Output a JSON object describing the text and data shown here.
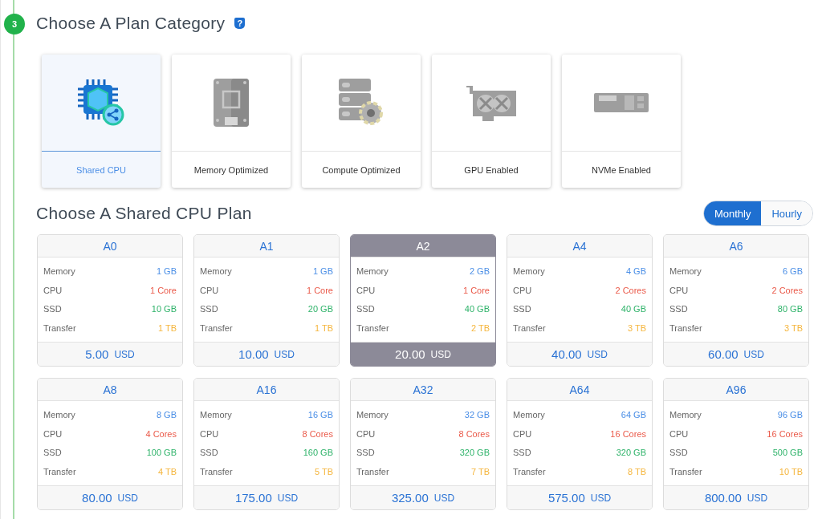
{
  "step": {
    "number": "3"
  },
  "category_section": {
    "title": "Choose A Plan Category",
    "help_icon": "?"
  },
  "categories": [
    {
      "label": "Shared CPU",
      "kind": "cpu",
      "selected": true
    },
    {
      "label": "Memory Optimized",
      "kind": "memory",
      "selected": false
    },
    {
      "label": "Compute Optimized",
      "kind": "server",
      "selected": false
    },
    {
      "label": "GPU Enabled",
      "kind": "gpu",
      "selected": false
    },
    {
      "label": "NVMe Enabled",
      "kind": "nvme",
      "selected": false
    }
  ],
  "plan_section": {
    "title": "Choose A Shared CPU Plan"
  },
  "billing_toggle": [
    {
      "label": "Monthly",
      "selected": true
    },
    {
      "label": "Hourly",
      "selected": false
    }
  ],
  "plans": [
    {
      "name": "A0",
      "selected": false,
      "specs": [
        {
          "label": "Memory",
          "value": "1 GB",
          "kind": "memory"
        },
        {
          "label": "CPU",
          "value": "1 Core",
          "kind": "cpu"
        },
        {
          "label": "SSD",
          "value": "10 GB",
          "kind": "ssd"
        },
        {
          "label": "Transfer",
          "value": "1 TB",
          "kind": "transfer"
        }
      ],
      "price": "5.00",
      "currency": "USD"
    },
    {
      "name": "A1",
      "selected": false,
      "specs": [
        {
          "label": "Memory",
          "value": "1 GB",
          "kind": "memory"
        },
        {
          "label": "CPU",
          "value": "1 Core",
          "kind": "cpu"
        },
        {
          "label": "SSD",
          "value": "20 GB",
          "kind": "ssd"
        },
        {
          "label": "Transfer",
          "value": "1 TB",
          "kind": "transfer"
        }
      ],
      "price": "10.00",
      "currency": "USD"
    },
    {
      "name": "A2",
      "selected": true,
      "specs": [
        {
          "label": "Memory",
          "value": "2 GB",
          "kind": "memory"
        },
        {
          "label": "CPU",
          "value": "1 Core",
          "kind": "cpu"
        },
        {
          "label": "SSD",
          "value": "40 GB",
          "kind": "ssd"
        },
        {
          "label": "Transfer",
          "value": "2 TB",
          "kind": "transfer"
        }
      ],
      "price": "20.00",
      "currency": "USD"
    },
    {
      "name": "A4",
      "selected": false,
      "specs": [
        {
          "label": "Memory",
          "value": "4 GB",
          "kind": "memory"
        },
        {
          "label": "CPU",
          "value": "2 Cores",
          "kind": "cpu"
        },
        {
          "label": "SSD",
          "value": "40 GB",
          "kind": "ssd"
        },
        {
          "label": "Transfer",
          "value": "3 TB",
          "kind": "transfer"
        }
      ],
      "price": "40.00",
      "currency": "USD"
    },
    {
      "name": "A6",
      "selected": false,
      "specs": [
        {
          "label": "Memory",
          "value": "6 GB",
          "kind": "memory"
        },
        {
          "label": "CPU",
          "value": "2 Cores",
          "kind": "cpu"
        },
        {
          "label": "SSD",
          "value": "80 GB",
          "kind": "ssd"
        },
        {
          "label": "Transfer",
          "value": "3 TB",
          "kind": "transfer"
        }
      ],
      "price": "60.00",
      "currency": "USD"
    },
    {
      "name": "A8",
      "selected": false,
      "specs": [
        {
          "label": "Memory",
          "value": "8 GB",
          "kind": "memory"
        },
        {
          "label": "CPU",
          "value": "4 Cores",
          "kind": "cpu"
        },
        {
          "label": "SSD",
          "value": "100 GB",
          "kind": "ssd"
        },
        {
          "label": "Transfer",
          "value": "4 TB",
          "kind": "transfer"
        }
      ],
      "price": "80.00",
      "currency": "USD"
    },
    {
      "name": "A16",
      "selected": false,
      "specs": [
        {
          "label": "Memory",
          "value": "16 GB",
          "kind": "memory"
        },
        {
          "label": "CPU",
          "value": "8 Cores",
          "kind": "cpu"
        },
        {
          "label": "SSD",
          "value": "160 GB",
          "kind": "ssd"
        },
        {
          "label": "Transfer",
          "value": "5 TB",
          "kind": "transfer"
        }
      ],
      "price": "175.00",
      "currency": "USD"
    },
    {
      "name": "A32",
      "selected": false,
      "specs": [
        {
          "label": "Memory",
          "value": "32 GB",
          "kind": "memory"
        },
        {
          "label": "CPU",
          "value": "8 Cores",
          "kind": "cpu"
        },
        {
          "label": "SSD",
          "value": "320 GB",
          "kind": "ssd"
        },
        {
          "label": "Transfer",
          "value": "7 TB",
          "kind": "transfer"
        }
      ],
      "price": "325.00",
      "currency": "USD"
    },
    {
      "name": "A64",
      "selected": false,
      "specs": [
        {
          "label": "Memory",
          "value": "64 GB",
          "kind": "memory"
        },
        {
          "label": "CPU",
          "value": "16 Cores",
          "kind": "cpu"
        },
        {
          "label": "SSD",
          "value": "320 GB",
          "kind": "ssd"
        },
        {
          "label": "Transfer",
          "value": "8 TB",
          "kind": "transfer"
        }
      ],
      "price": "575.00",
      "currency": "USD"
    },
    {
      "name": "A96",
      "selected": false,
      "specs": [
        {
          "label": "Memory",
          "value": "96 GB",
          "kind": "memory"
        },
        {
          "label": "CPU",
          "value": "16 Cores",
          "kind": "cpu"
        },
        {
          "label": "SSD",
          "value": "500 GB",
          "kind": "ssd"
        },
        {
          "label": "Transfer",
          "value": "10 TB",
          "kind": "transfer"
        }
      ],
      "price": "800.00",
      "currency": "USD"
    }
  ]
}
